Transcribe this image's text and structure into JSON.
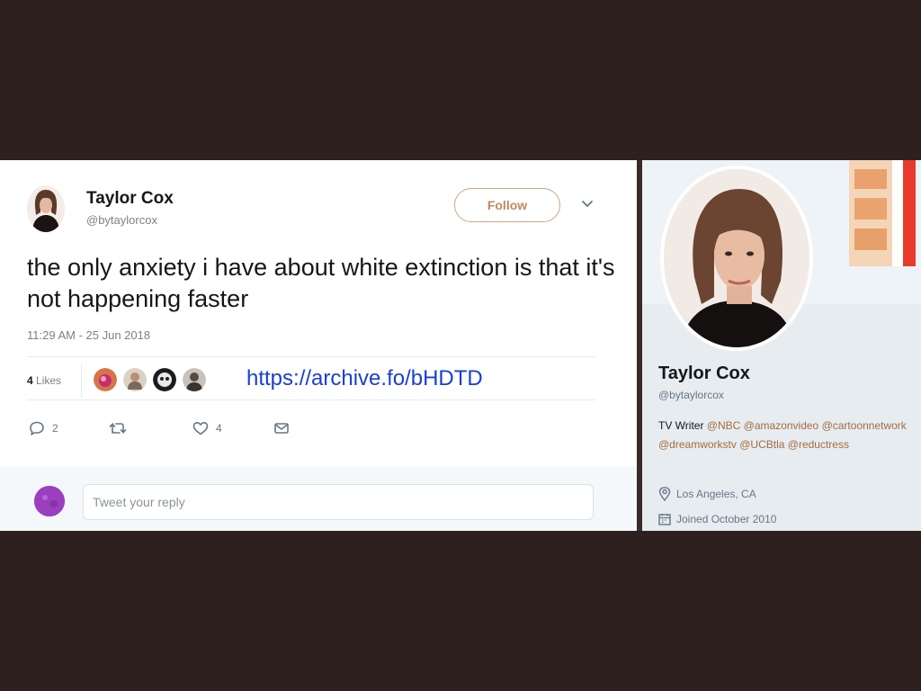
{
  "tweet": {
    "author_name": "Taylor Cox",
    "author_handle": "@bytaylorcox",
    "follow_label": "Follow",
    "text": "the only anxiety i have about white extinction is that it's not happening faster",
    "timestamp": "11:29 AM - 25 Jun 2018",
    "likes_count": "4",
    "likes_label": "Likes",
    "archive_link": "https://archive.fo/bHDTD",
    "actions": {
      "reply_count": "2",
      "retweet_count": "",
      "like_count": "4"
    },
    "reply_placeholder": "Tweet your reply"
  },
  "profile": {
    "name": "Taylor Cox",
    "handle": "@bytaylorcox",
    "bio_prefix": "TV Writer",
    "bio_mentions": [
      "@NBC",
      "@amazonvideo",
      "@cartoonnetwork",
      "@dreamworkstv",
      "@UCBtla",
      "@reductress"
    ],
    "location": "Los Angeles, CA",
    "joined": "Joined October 2010"
  },
  "icons": {
    "reply": "reply-icon",
    "retweet": "retweet-icon",
    "like": "heart-icon",
    "dm": "envelope-icon",
    "caret": "chevron-down-icon",
    "location": "location-pin-icon",
    "calendar": "calendar-icon"
  },
  "colors": {
    "backdrop": "#2f2020",
    "link_blue": "#1a3fd1",
    "follow_accent": "#c08860",
    "mention_color": "#a86a3e"
  }
}
